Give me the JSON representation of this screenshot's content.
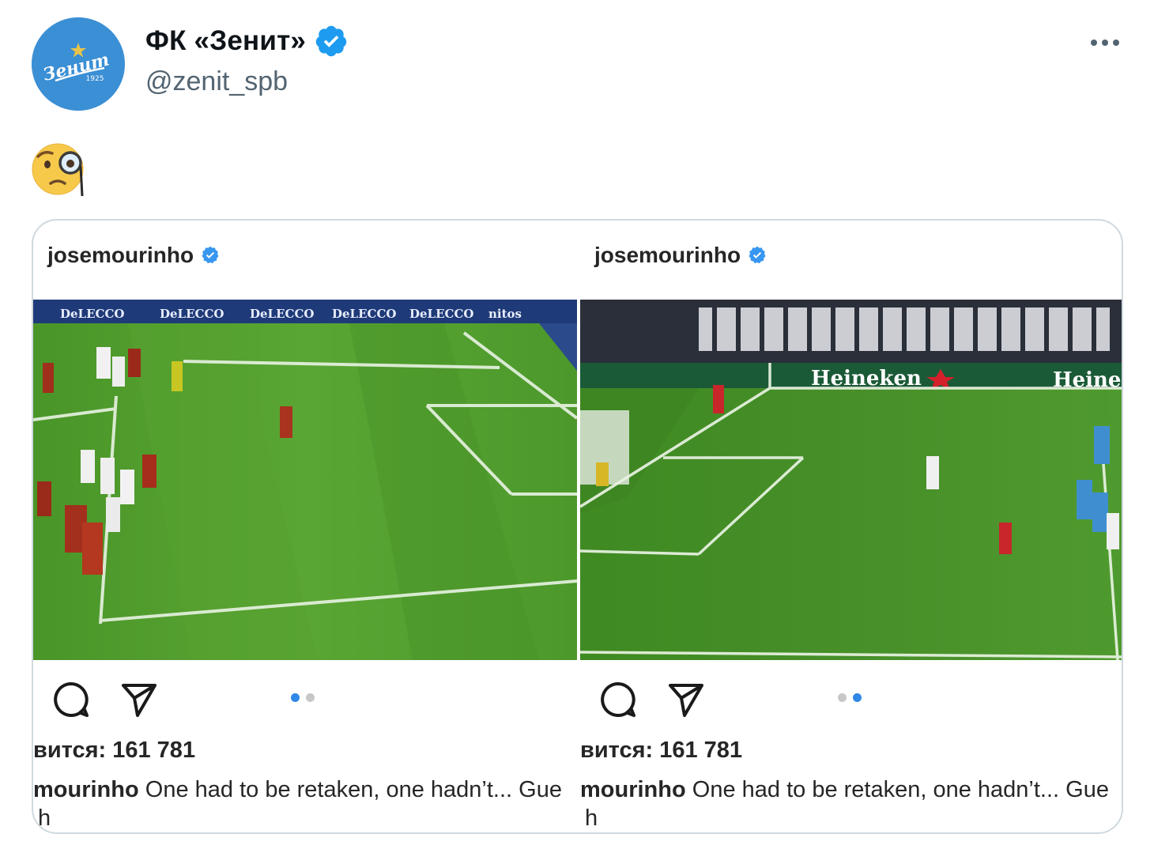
{
  "tweet": {
    "author": {
      "display_name": "ФК «Зенит»",
      "handle": "@zenit_spb",
      "verified": true,
      "avatar": {
        "wordmark": "Зенит",
        "year": "1925",
        "color": "#3b8fd4"
      }
    },
    "text_emoji": "face-with-monocle",
    "more_icon": "more-dots-icon"
  },
  "embedded_image": {
    "posts": [
      {
        "username": "josemourinho",
        "verified": true,
        "likes_text": "вится: 161 781",
        "caption_user": "mourinho",
        "caption_text": " One had to be retaken, one hadn’t... Gue",
        "caption_overflow": "h",
        "carousel_active_index": 0,
        "carousel_count": 2,
        "image_ads": [
          "DeLECCO",
          "DeLECCO",
          "DeLECCO",
          "DeLECCO",
          "DeLECCO",
          "nitos"
        ]
      },
      {
        "username": "josemourinho",
        "verified": true,
        "likes_text": "вится: 161 781",
        "caption_user": "mourinho",
        "caption_text": " One had to be retaken, one hadn’t... Gue",
        "caption_overflow": "h",
        "carousel_active_index": 1,
        "carousel_count": 2,
        "image_ads": [
          "Heineken",
          "Heine"
        ]
      }
    ]
  },
  "colors": {
    "verified_twitter": "#1d9bf0",
    "verified_instagram": "#3897f0",
    "pitch_green": "#4f9a2e",
    "dot_active": "#2f88e6",
    "dot_inactive": "#c7c7c7"
  }
}
